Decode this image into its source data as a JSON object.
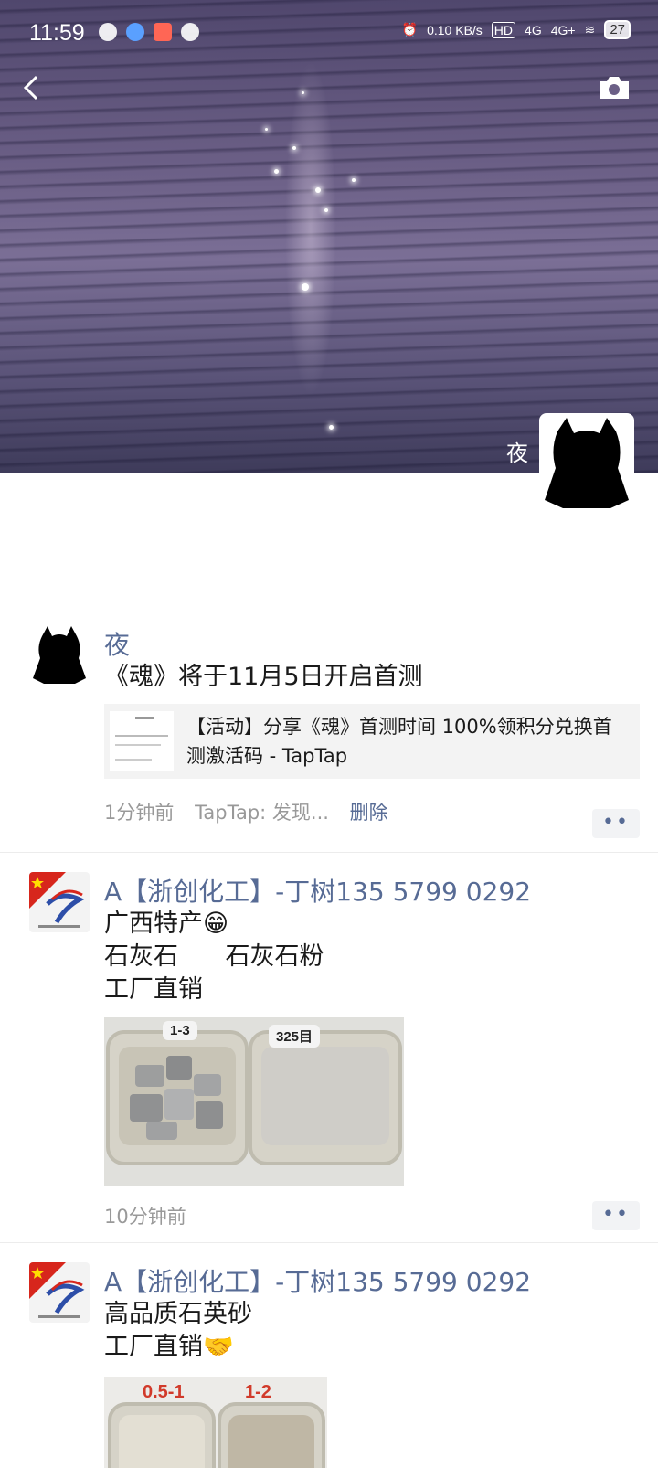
{
  "status_bar": {
    "time": "11:59",
    "net_speed": "0.10 KB/s",
    "signal1": "4G",
    "signal2": "4G+",
    "battery": "27"
  },
  "header": {
    "back_icon": "back-icon",
    "camera_icon": "camera-icon",
    "owner_name": "夜"
  },
  "posts": [
    {
      "author": "夜",
      "text": "《魂》将于11月5日开启首测",
      "link_title": "【活动】分享《魂》首测时间 100%领积分兑换首测激活码 - TapTap",
      "time": "1分钟前",
      "source": "TapTap: 发现...",
      "delete_label": "删除"
    },
    {
      "author": "A【浙创化工】-丁树135 5799 0292",
      "text": "广西特产😁\n石灰石      石灰石粉\n工厂直销",
      "image_tags": [
        "1-3",
        "325目"
      ],
      "time": "10分钟前"
    },
    {
      "author": "A【浙创化工】-丁树135 5799 0292",
      "text": "高品质石英砂\n工厂直销🤝",
      "image_tags": [
        "0.5-1",
        "1-2"
      ]
    }
  ],
  "colors": {
    "link_name": "#576b95",
    "meta": "#999999"
  }
}
